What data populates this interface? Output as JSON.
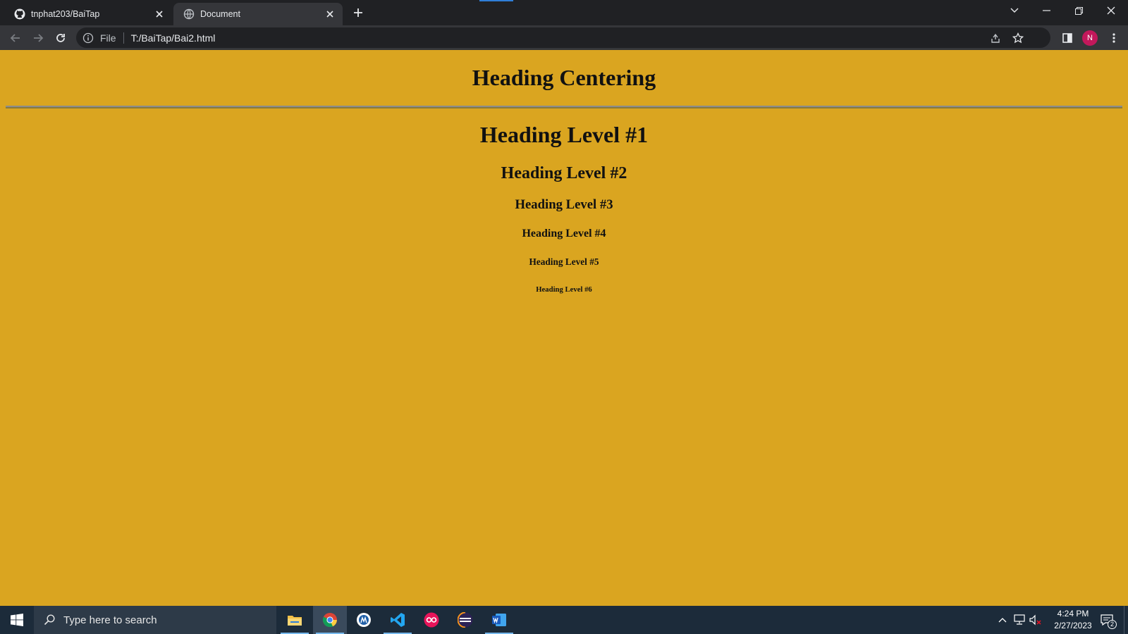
{
  "browser": {
    "tabs": [
      {
        "title": "tnphat203/BaiTap",
        "favicon": "github-icon",
        "active": false
      },
      {
        "title": "Document",
        "favicon": "globe-icon",
        "active": true
      }
    ],
    "omnibox": {
      "security_label": "File",
      "url": "T:/BaiTap/Bai2.html"
    },
    "profile_initial": "N"
  },
  "page": {
    "background": "#daa520",
    "heading_centering": "Heading Centering",
    "headings": [
      "Heading Level #1",
      "Heading Level #2",
      "Heading Level #3",
      "Heading Level #4",
      "Heading Level #5",
      "Heading Level #6"
    ]
  },
  "taskbar": {
    "search_placeholder": "Type here to search",
    "apps": [
      "file-explorer-icon",
      "chrome-icon",
      "app-icon",
      "vscode-icon",
      "flickr-icon",
      "eclipse-icon",
      "word-icon"
    ],
    "clock": {
      "time": "4:24 PM",
      "date": "2/27/2023"
    },
    "notification_count": "2"
  }
}
